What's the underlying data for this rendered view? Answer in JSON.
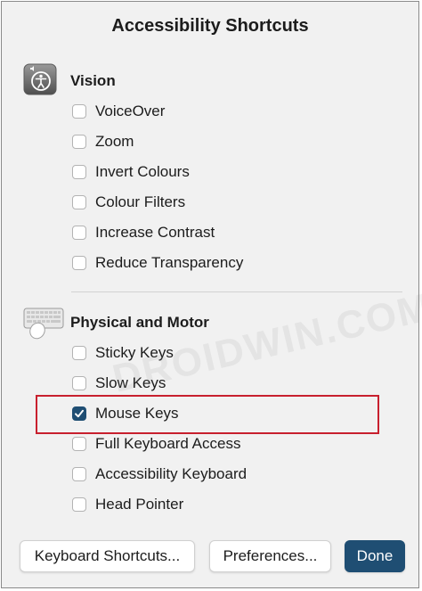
{
  "dialog": {
    "title": "Accessibility Shortcuts"
  },
  "vision": {
    "label": "Vision",
    "icon": "accessibility-icon",
    "options": [
      {
        "label": "VoiceOver",
        "checked": false
      },
      {
        "label": "Zoom",
        "checked": false
      },
      {
        "label": "Invert Colours",
        "checked": false
      },
      {
        "label": "Colour Filters",
        "checked": false
      },
      {
        "label": "Increase Contrast",
        "checked": false
      },
      {
        "label": "Reduce Transparency",
        "checked": false
      }
    ]
  },
  "physical": {
    "label": "Physical and Motor",
    "icon": "keyboard-mouse-icon",
    "options": [
      {
        "label": "Sticky Keys",
        "checked": false
      },
      {
        "label": "Slow Keys",
        "checked": false
      },
      {
        "label": "Mouse Keys",
        "checked": true
      },
      {
        "label": "Full Keyboard Access",
        "checked": false
      },
      {
        "label": "Accessibility Keyboard",
        "checked": false
      },
      {
        "label": "Head Pointer",
        "checked": false
      }
    ]
  },
  "buttons": {
    "keyboard_shortcuts": "Keyboard Shortcuts...",
    "preferences": "Preferences...",
    "done": "Done"
  },
  "watermark": "DROIDWIN.COM",
  "colors": {
    "accent": "#1f4e73",
    "highlight": "#c8202e",
    "panel_bg": "#f1f1f1"
  }
}
